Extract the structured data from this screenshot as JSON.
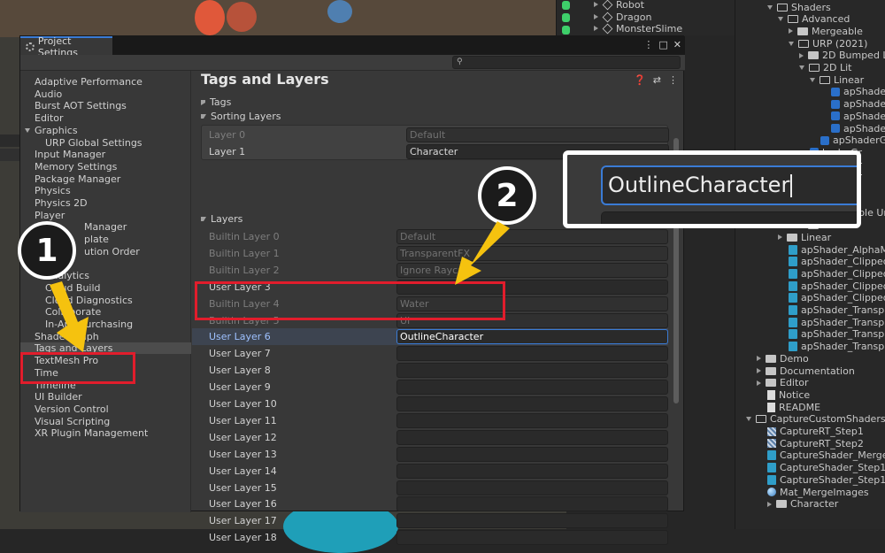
{
  "hierarchy": {
    "items": [
      {
        "label": "Robot"
      },
      {
        "label": "Dragon"
      },
      {
        "label": "MonsterSlime"
      }
    ]
  },
  "project": {
    "items": [
      {
        "label": "Shaders",
        "icon": "folder-open-icon"
      },
      {
        "label": "Advanced",
        "icon": "folder-open-icon"
      },
      {
        "label": "Mergeable",
        "icon": "folder-icon"
      },
      {
        "label": "URP (2021)",
        "icon": "folder-open-icon"
      },
      {
        "label": "2D Bumped Li",
        "icon": "folder-icon"
      },
      {
        "label": "2D Lit",
        "icon": "folder-open-icon"
      },
      {
        "label": "Linear",
        "icon": "folder-open-icon"
      },
      {
        "label": "apShader",
        "icon": "shader-icon"
      },
      {
        "label": "apShader",
        "icon": "shader-icon"
      },
      {
        "label": "apShader",
        "icon": "shader-icon"
      },
      {
        "label": "apShader",
        "icon": "shader-icon"
      },
      {
        "label": "apShaderG",
        "icon": "shader-icon"
      },
      {
        "label": "haderGr",
        "icon": "shader-icon"
      },
      {
        "label": "haderGr",
        "icon": "shader-icon"
      },
      {
        "label": "haderGr",
        "icon": "shader-icon"
      },
      {
        "label": "Lit",
        "icon": "folder-icon"
      },
      {
        "label": "le 2D",
        "icon": "folder-icon"
      },
      {
        "label": "Mergeable Un",
        "icon": "folder-icon"
      },
      {
        "label": "Unlit",
        "icon": "folder-icon"
      },
      {
        "label": "Linear",
        "icon": "folder-icon"
      },
      {
        "label": "apShader_AlphaMa",
        "icon": "script-icon"
      },
      {
        "label": "apShader_ClippedW",
        "icon": "script-icon"
      },
      {
        "label": "apShader_ClippedW",
        "icon": "script-icon"
      },
      {
        "label": "apShader_ClippedW",
        "icon": "script-icon"
      },
      {
        "label": "apShader_ClippedW",
        "icon": "script-icon"
      },
      {
        "label": "apShader_Transpar",
        "icon": "script-icon"
      },
      {
        "label": "apShader_Transpar",
        "icon": "script-icon"
      },
      {
        "label": "apShader_Transpar",
        "icon": "script-icon"
      },
      {
        "label": "apShader_Transpar",
        "icon": "script-icon"
      },
      {
        "label": "Demo",
        "icon": "folder-icon"
      },
      {
        "label": "Documentation",
        "icon": "folder-icon"
      },
      {
        "label": "Editor",
        "icon": "folder-icon"
      },
      {
        "label": "Notice",
        "icon": "text-icon"
      },
      {
        "label": "README",
        "icon": "text-icon"
      },
      {
        "label": "CaptureCustomShaders",
        "icon": "folder-open-icon"
      },
      {
        "label": "CaptureRT_Step1",
        "icon": "render-texture-icon"
      },
      {
        "label": "CaptureRT_Step2",
        "icon": "render-texture-icon"
      },
      {
        "label": "CaptureShader_MergeIn",
        "icon": "script-icon"
      },
      {
        "label": "CaptureShader_Step1_C",
        "icon": "script-icon"
      },
      {
        "label": "CaptureShader_Step1_N",
        "icon": "script-icon"
      },
      {
        "label": "Mat_MergeImages",
        "icon": "material-icon"
      },
      {
        "label": "Character",
        "icon": "folder-icon"
      }
    ]
  },
  "window": {
    "tab_title": "Project Settings",
    "search_placeholder": ""
  },
  "sidebar": {
    "items": [
      {
        "label": "Adaptive Performance"
      },
      {
        "label": "Audio"
      },
      {
        "label": "Burst AOT Settings"
      },
      {
        "label": "Editor"
      },
      {
        "label": "Graphics"
      },
      {
        "label": "URP Global Settings"
      },
      {
        "label": "Input Manager"
      },
      {
        "label": "Memory Settings"
      },
      {
        "label": "Package Manager"
      },
      {
        "label": "Physics"
      },
      {
        "label": "Physics 2D"
      },
      {
        "label": "Player"
      },
      {
        "label": "Manager"
      },
      {
        "label": "plate"
      },
      {
        "label": "ution Order"
      },
      {
        "label": "Ads"
      },
      {
        "label": "Analytics"
      },
      {
        "label": "Cloud Build"
      },
      {
        "label": "Cloud Diagnostics"
      },
      {
        "label": "Collaborate"
      },
      {
        "label": "In-App Purchasing"
      },
      {
        "label": "ShaderGraph"
      },
      {
        "label": "Tags and Layers"
      },
      {
        "label": "TextMesh Pro"
      },
      {
        "label": "Time"
      },
      {
        "label": "Timeline"
      },
      {
        "label": "UI Builder"
      },
      {
        "label": "Version Control"
      },
      {
        "label": "Visual Scripting"
      },
      {
        "label": "XR Plugin Management"
      }
    ]
  },
  "content": {
    "title": "Tags and Layers",
    "tags_label": "Tags",
    "sorting_label": "Sorting Layers",
    "sorting_layers": [
      {
        "label": "Layer 0",
        "value": "Default"
      },
      {
        "label": "Layer 1",
        "value": "Character"
      }
    ],
    "layers_label": "Layers",
    "layers": [
      {
        "label": "Builtin Layer 0",
        "value": "Default"
      },
      {
        "label": "Builtin Layer 1",
        "value": "TransparentFX"
      },
      {
        "label": "Builtin Layer 2",
        "value": "Ignore Raycast"
      },
      {
        "label": "User Layer 3",
        "value": ""
      },
      {
        "label": "Builtin Layer 4",
        "value": "Water"
      },
      {
        "label": "Builtin Layer 5",
        "value": "UI"
      },
      {
        "label": "User Layer 6",
        "value": "OutlineCharacter"
      },
      {
        "label": "User Layer 7",
        "value": ""
      },
      {
        "label": "User Layer 8",
        "value": ""
      },
      {
        "label": "User Layer 9",
        "value": ""
      },
      {
        "label": "User Layer 10",
        "value": ""
      },
      {
        "label": "User Layer 11",
        "value": ""
      },
      {
        "label": "User Layer 12",
        "value": ""
      },
      {
        "label": "User Layer 13",
        "value": ""
      },
      {
        "label": "User Layer 14",
        "value": ""
      },
      {
        "label": "User Layer 15",
        "value": ""
      },
      {
        "label": "User Layer 16",
        "value": ""
      },
      {
        "label": "User Layer 17",
        "value": ""
      },
      {
        "label": "User Layer 18",
        "value": ""
      }
    ]
  },
  "annotations": {
    "step1": "1",
    "step2": "2",
    "zoom_text": "OutlineCharacter"
  },
  "colors": {
    "highlight_red": "#e11d2c",
    "arrow_yellow": "#f5c20f",
    "focus_blue": "#3a7bd5"
  }
}
